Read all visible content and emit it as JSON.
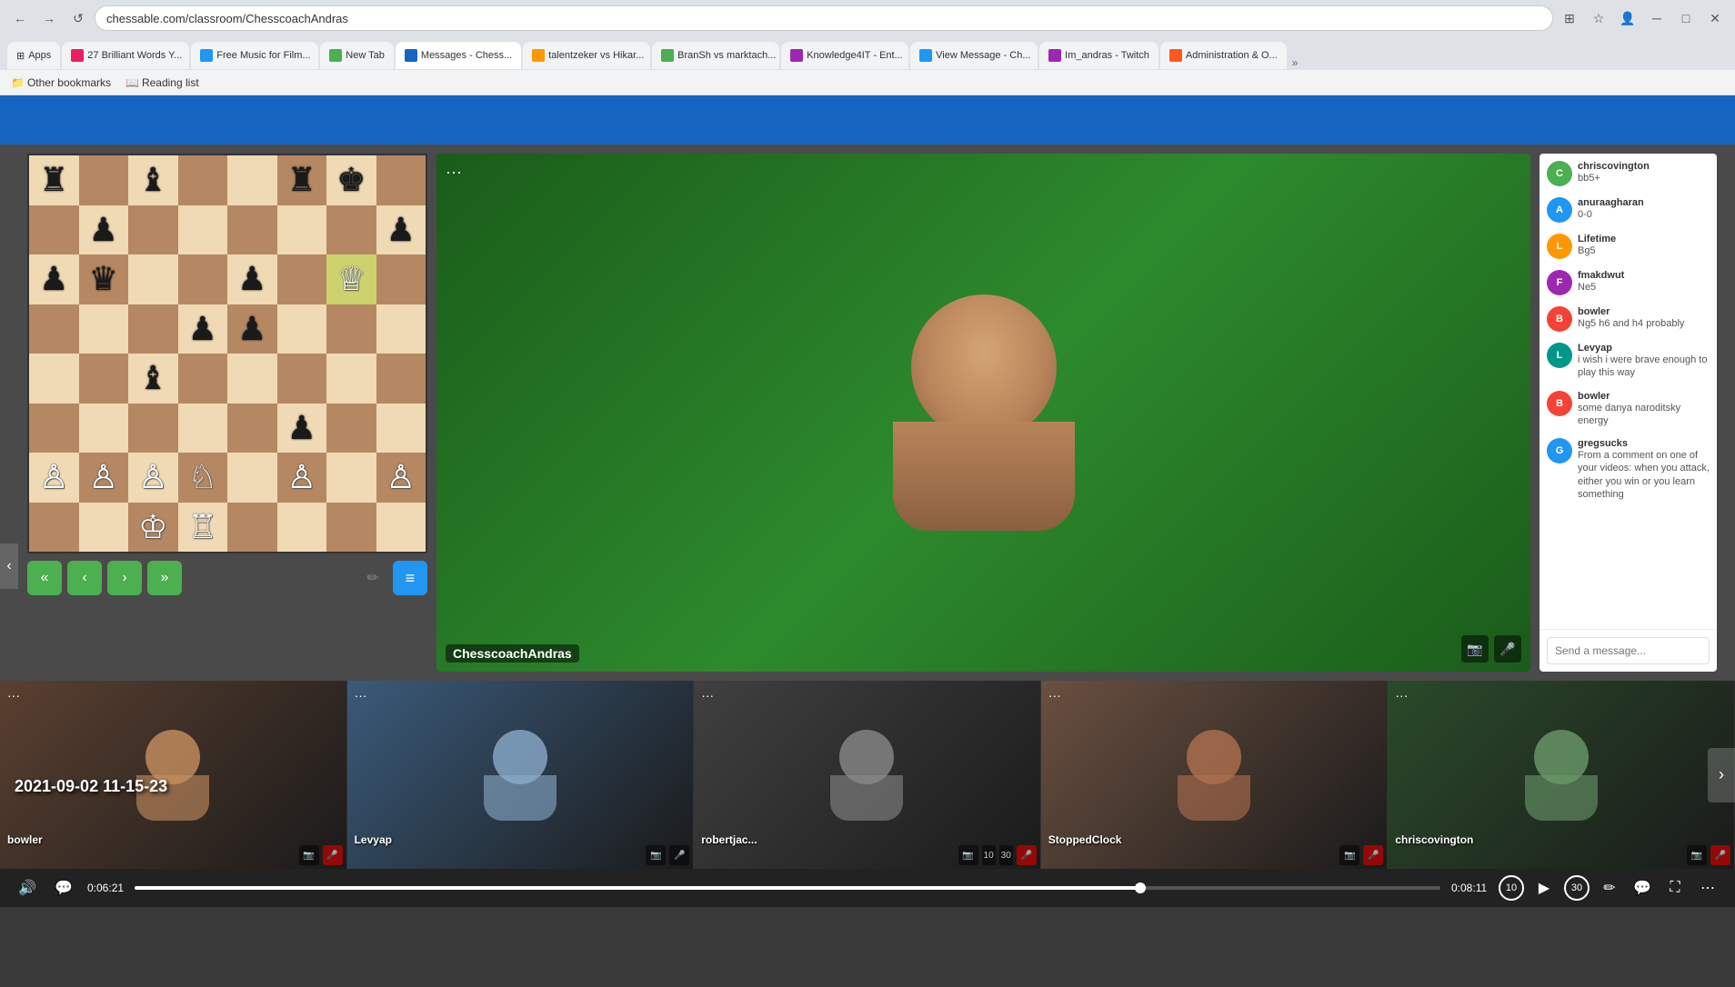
{
  "browser": {
    "address": "chessable.com/classroom/ChesscoachAndras",
    "apps_label": "Apps",
    "tabs": [
      {
        "label": "27 Brilliant Words Y...",
        "favicon_color": "#E91E63",
        "active": false
      },
      {
        "label": "Free Music for Film...",
        "favicon_color": "#2196F3",
        "active": false
      },
      {
        "label": "New Tab",
        "favicon_color": "#4CAF50",
        "active": false
      },
      {
        "label": "Messages - Chess...",
        "favicon_color": "#1565C0",
        "active": false
      },
      {
        "label": "talentzeker vs Hikar...",
        "favicon_color": "#FF9800",
        "active": false
      },
      {
        "label": "BranSh vs marktach...",
        "favicon_color": "#4CAF50",
        "active": false
      },
      {
        "label": "Knowledge4IT - Ent...",
        "favicon_color": "#9C27B0",
        "active": false
      },
      {
        "label": "View Message - Ch...",
        "favicon_color": "#2196F3",
        "active": false
      },
      {
        "label": "Im_andras - Twitch",
        "favicon_color": "#9C27B0",
        "active": false
      },
      {
        "label": "Administration & O...",
        "favicon_color": "#FF5722",
        "active": false
      }
    ],
    "bookmarks": [
      {
        "label": "Other bookmarks"
      },
      {
        "label": "Reading list"
      }
    ]
  },
  "chess": {
    "board": [
      [
        "bR",
        "",
        "bB",
        "",
        "",
        "bR",
        "bK",
        ""
      ],
      [
        "",
        "bP",
        "",
        "",
        "",
        "",
        "",
        "bP"
      ],
      [
        "bP",
        "bQ",
        "",
        "",
        "bP",
        "",
        "wQ",
        ""
      ],
      [
        "",
        "",
        "",
        "bP",
        "bP",
        "",
        "",
        ""
      ],
      [
        "",
        "",
        "bB",
        "",
        "",
        "",
        "",
        ""
      ],
      [
        "",
        "",
        "",
        "",
        "",
        "bP",
        "",
        ""
      ],
      [
        "wP",
        "wP",
        "wP",
        "wN",
        "",
        "wP",
        "",
        "wP"
      ],
      [
        "",
        "",
        "wK",
        "wR",
        "",
        "",
        "",
        ""
      ]
    ],
    "controls": {
      "first": "«",
      "prev": "‹",
      "next": "›",
      "last": "»"
    }
  },
  "instructor": {
    "name": "ChesscoachAndras",
    "dots_label": "···"
  },
  "chat": {
    "messages": [
      {
        "user": "chriscovington",
        "text": "bb5+",
        "avatar_initials": "C",
        "avatar_color": "av-green"
      },
      {
        "user": "anuraagharan",
        "text": "0-0",
        "avatar_initials": "A",
        "avatar_color": "av-blue"
      },
      {
        "user": "Lifetime",
        "text": "Bg5",
        "avatar_initials": "L",
        "avatar_color": "av-orange"
      },
      {
        "user": "fmakdwut",
        "text": "Ne5",
        "avatar_initials": "F",
        "avatar_color": "av-purple"
      },
      {
        "user": "bowler",
        "text": "Ng5 h6 and h4 probably",
        "avatar_initials": "B",
        "avatar_color": "av-red"
      },
      {
        "user": "Levyap",
        "text": "i wish i were brave enough to play this way",
        "avatar_initials": "L",
        "avatar_color": "av-teal"
      },
      {
        "user": "bowler",
        "text": "some danya naroditsky energy",
        "avatar_initials": "B",
        "avatar_color": "av-red"
      },
      {
        "user": "gregsucks",
        "text": "From a comment on one of your videos: when you attack, either you win or you learn something",
        "avatar_initials": "G",
        "avatar_color": "av-blue"
      }
    ],
    "input_placeholder": "Send a message...",
    "scrollbar": true
  },
  "participants": [
    {
      "name": "bowler",
      "has_dots": true,
      "video_muted": false,
      "audio_muted": true
    },
    {
      "name": "Levyap",
      "has_dots": true,
      "video_muted": false,
      "audio_muted": false
    },
    {
      "name": "robertjac...",
      "has_dots": true,
      "video_muted": false,
      "audio_muted": true
    },
    {
      "name": "StoppedClock",
      "has_dots": true,
      "video_muted": false,
      "audio_muted": true
    },
    {
      "name": "chriscovington",
      "has_dots": true,
      "video_muted": false,
      "audio_muted": true
    }
  ],
  "timeline": {
    "current_time": "0:06:21",
    "total_time": "0:08:11",
    "progress_percent": 77,
    "timestamp": "2021-09-02 11-15-23"
  },
  "toolbar": {
    "play_label": "▶",
    "skip_back_label": "10",
    "skip_fwd_label": "30"
  }
}
